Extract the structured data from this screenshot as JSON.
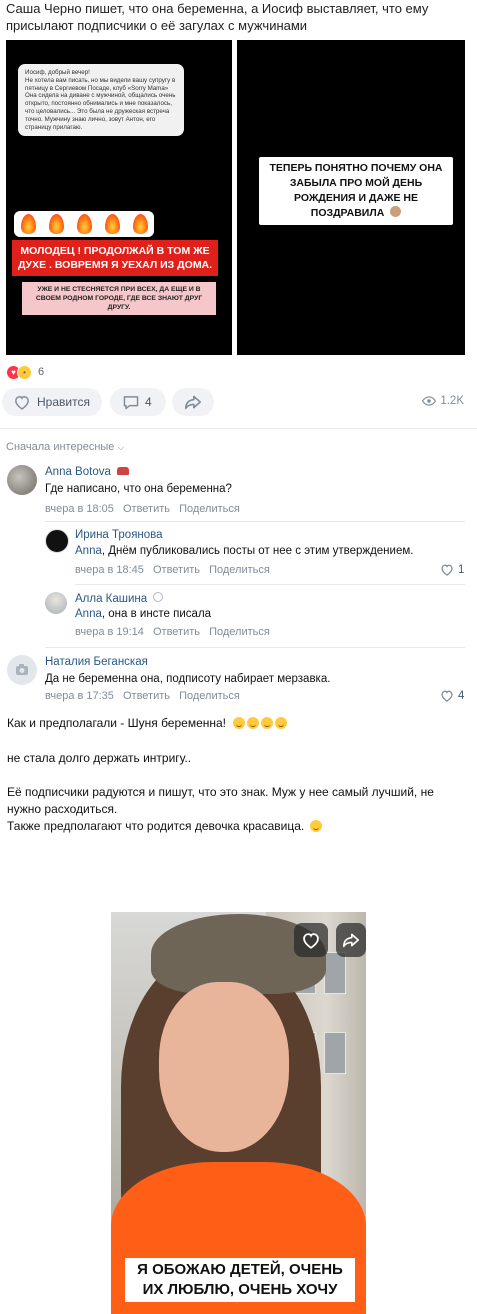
{
  "intro_text": "Саша Черно пишет, что она беременна, а Иосиф выставляет, что ему присылают подписчики о её загулах с мужчинами",
  "story_left": {
    "message": "Иосиф, добрый вечер!\nНе хотела вам писать, но мы видели вашу супругу в пятницу в Сергиевом Посаде, клуб «Sorry Mama»\nОна сидела на диване с мужчиной, общались очень открыто, постоянно обнимались и мне показалось, что целовались... Это была не дружеская встреча точно. Мужчину знаю лично, зовут Антон, его страницу прилагаю.",
    "red_text": "МОЛОДЕЦ ! ПРОДОЛЖАЙ В ТОМ ЖЕ ДУХЕ . ВОВРЕМЯ Я УЕХАЛ ИЗ ДОМА.",
    "pink_text": "УЖЕ И НЕ СТЕСНЯЕТСЯ ПРИ ВСЕХ, ДА ЕЩЕ И В СВОЕМ РОДНОМ ГОРОДЕ, ГДЕ ВСЕ ЗНАЮТ ДРУГ ДРУГУ."
  },
  "story_right": {
    "text": "ТЕПЕРЬ ПОНЯТНО ПОЧЕМУ ОНА ЗАБЫЛА ПРО МОЙ ДЕНЬ РОЖДЕНИЯ И ДАЖЕ НЕ ПОЗДРАВИЛА"
  },
  "reactions": {
    "count": "6"
  },
  "actions": {
    "like_label": "Нравится",
    "comments_count": "4",
    "views": "1.2K"
  },
  "comments_sort": "Сначала интересные",
  "comments": [
    {
      "author": "Anna Botova",
      "text": "Где написано, что она беременна?",
      "time": "вчера в 18:05",
      "reply": "Ответить",
      "share": "Поделиться",
      "likes": ""
    },
    {
      "author": "Ирина Троянова",
      "mention": "Anna",
      "text": ", Днём публиковались посты от нее с этим утверждением.",
      "time": "вчера в 18:45",
      "reply": "Ответить",
      "share": "Поделиться",
      "likes": "1"
    },
    {
      "author": "Алла Кашина",
      "mention": "Anna",
      "text": ", она в инсте писала",
      "time": "вчера в 19:14",
      "reply": "Ответить",
      "share": "Поделиться",
      "likes": ""
    },
    {
      "author": "Наталия Беганская",
      "text": "Да не беременна она, подписоту набирает мерзавка.",
      "time": "вчера в 17:35",
      "reply": "Ответить",
      "share": "Поделиться",
      "likes": "4"
    }
  ],
  "post": {
    "line1": "Как и предполагали - Шуня беременна!",
    "line2": "не стала долго держать интригу..",
    "line3": "Её подписчики радуются и пишут, что это знак. Муж у нее самый лучший, не нужно расходиться.",
    "line4": "Также предполагают что родится девочка красавица."
  },
  "video": {
    "caption": "Я ОБОЖАЮ ДЕТЕЙ, ОЧЕНЬ ИХ ЛЮБЛЮ, ОЧЕНЬ ХОЧУ"
  }
}
